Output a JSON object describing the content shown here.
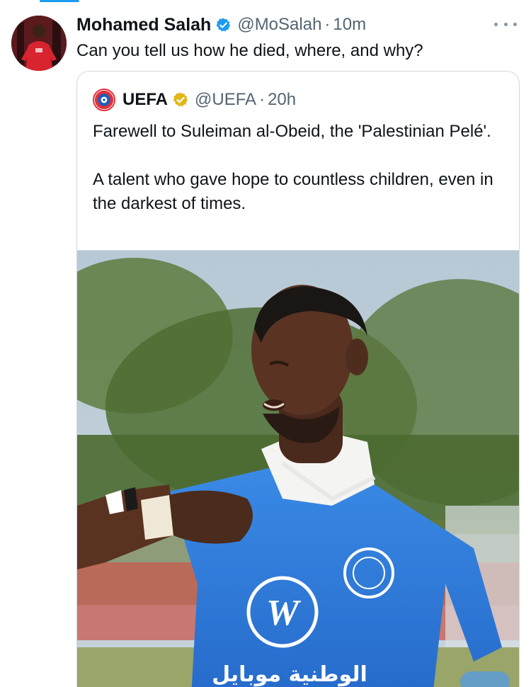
{
  "tweet": {
    "author_name": "Mohamed Salah",
    "handle": "@MoSalah",
    "separator": "·",
    "time": "10m",
    "text": "Can you tell us how he died, where, and why?",
    "avatar_icon": "user-avatar-photo",
    "more_icon": "more-options-icon"
  },
  "quoted": {
    "author_name": "UEFA",
    "handle": "@UEFA",
    "separator": "·",
    "time": "20h",
    "paragraph_1": "Farewell to Suleiman al-Obeid, the 'Palestinian Pelé'.",
    "paragraph_2": "A talent who gave hope to countless children, even in the darkest of times.",
    "verified_badge": "gold-verified-icon",
    "shirt_arabic": "الوطنية موبايل",
    "shirt_logo": "W"
  },
  "colors": {
    "accent": "#1d9bf0",
    "text": "#0f1419",
    "secondary": "#536471",
    "border": "#cfd9de",
    "gold": "#e2b719",
    "jersey": "#2f7fe0"
  }
}
